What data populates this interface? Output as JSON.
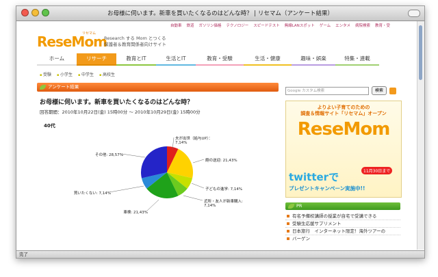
{
  "window": {
    "title": "お母様に伺います。新車を買いたくなるのはどんな時？ | リセマム（アンケート結果）"
  },
  "status_text": "完了",
  "site": {
    "top_nav": [
      "自動車",
      "鉄道",
      "ガソリン価格",
      "テクノロジー",
      "スピードテスト",
      "無線LANスポット",
      "ゲーム",
      "エンタメ",
      "病院検索",
      "教育・受"
    ],
    "logo": "ReseMom",
    "logo_ruby": "リセマム",
    "tagline_1": "Research する Mom とつくる",
    "tagline_2": "保護者＆教育関係者向けサイト",
    "nav_tabs": [
      "ホーム",
      "リサーチ",
      "教育とIT",
      "生活とIT",
      "教育・受験",
      "生活・健康",
      "趣味・娯楽",
      "特集・連載"
    ],
    "active_tab": "リサーチ",
    "sub_nav": [
      "受験",
      "小学生",
      "中学生",
      "高校生"
    ]
  },
  "main": {
    "section_label": "アンケート結果",
    "question": "お母様に伺います。新車を買いたくなるのはどんな時？",
    "period": "回答期間：2010年10月22日(金) 15時00分 〜 2010年10月29日(金) 15時00分",
    "age_group": "40代"
  },
  "chart_data": {
    "type": "pie",
    "title": "40代",
    "slices": [
      {
        "label": "夫が出世（給与UP）：",
        "value": 7.14,
        "color": "#e0201b"
      },
      {
        "label": "飽の送迎: ",
        "value": 21.43,
        "color": "#ffd200"
      },
      {
        "label": "子どもの進学: ",
        "value": 7.14,
        "color": "#c7e000"
      },
      {
        "label": "近所・友人が新車購入: ",
        "value": 7.14,
        "color": "#6ccb1f"
      },
      {
        "label": "車検: ",
        "value": 21.43,
        "color": "#1fa21a"
      },
      {
        "label": "買いたくない: ",
        "value": 7.14,
        "color": "#2a8ad8"
      },
      {
        "label": "その他: ",
        "value": 28.57,
        "color": "#2424c8"
      }
    ],
    "value_suffix": "%"
  },
  "sidebar": {
    "search_placeholder": "Google カスタム検索",
    "search_button": "検索",
    "ad_line1": "よりよい子育てのための",
    "ad_line2": "調査＆情報サイト「リセマム」オープン",
    "ad_logo": "ReseMom",
    "ad_twitter": "twitterで",
    "ad_date": "11月30日まで",
    "ad_campaign": "プレゼントキャンペーン実施中!!",
    "pr_label": "PR",
    "pr_items": [
      "有名予備校講師の授業が自宅で受講できる",
      "受験生応援サプリメント",
      "日本旅行　インターネット限定！海外ツアーの",
      "バーゲン"
    ]
  }
}
